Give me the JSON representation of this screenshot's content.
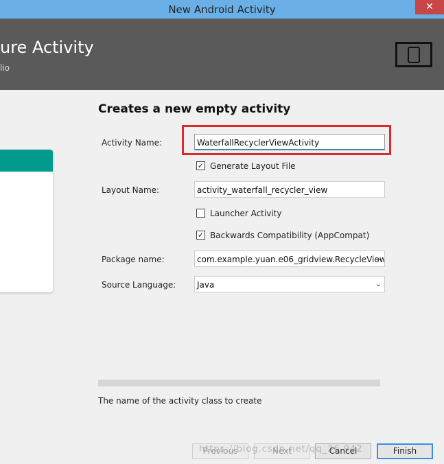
{
  "window": {
    "title": "New Android Activity",
    "close_glyph": "✕"
  },
  "header": {
    "heading": "ure Activity",
    "subheading": "lio",
    "icon": "device-frame-icon"
  },
  "form": {
    "title": "Creates a new empty activity",
    "activity_name": {
      "label": "Activity Name:",
      "value": "WaterfallRecyclerViewActivity"
    },
    "generate_layout": {
      "label": "Generate Layout File",
      "checked": true
    },
    "layout_name": {
      "label": "Layout Name:",
      "value": "activity_waterfall_recycler_view"
    },
    "launcher": {
      "label": "Launcher Activity",
      "checked": false
    },
    "backwards": {
      "label": "Backwards Compatibility (AppCompat)",
      "checked": true
    },
    "package_name": {
      "label": "Package name:",
      "value": "com.example.yuan.e06_gridview.RecycleView"
    },
    "source_language": {
      "label": "Source Language:",
      "value": "Java"
    },
    "check_glyph": "✓",
    "chevron_glyph": "⌄"
  },
  "hint": "The name of the activity class to create",
  "buttons": {
    "previous": "Previous",
    "next": "Next",
    "cancel": "Cancel",
    "finish": "Finish"
  },
  "watermark": "https://blog.csdn.net/qq_36 942",
  "colors": {
    "accent": "#009b8c",
    "highlight": "#e0282e",
    "header": "#5a5a5a",
    "titlebar": "#6ab0e6"
  }
}
